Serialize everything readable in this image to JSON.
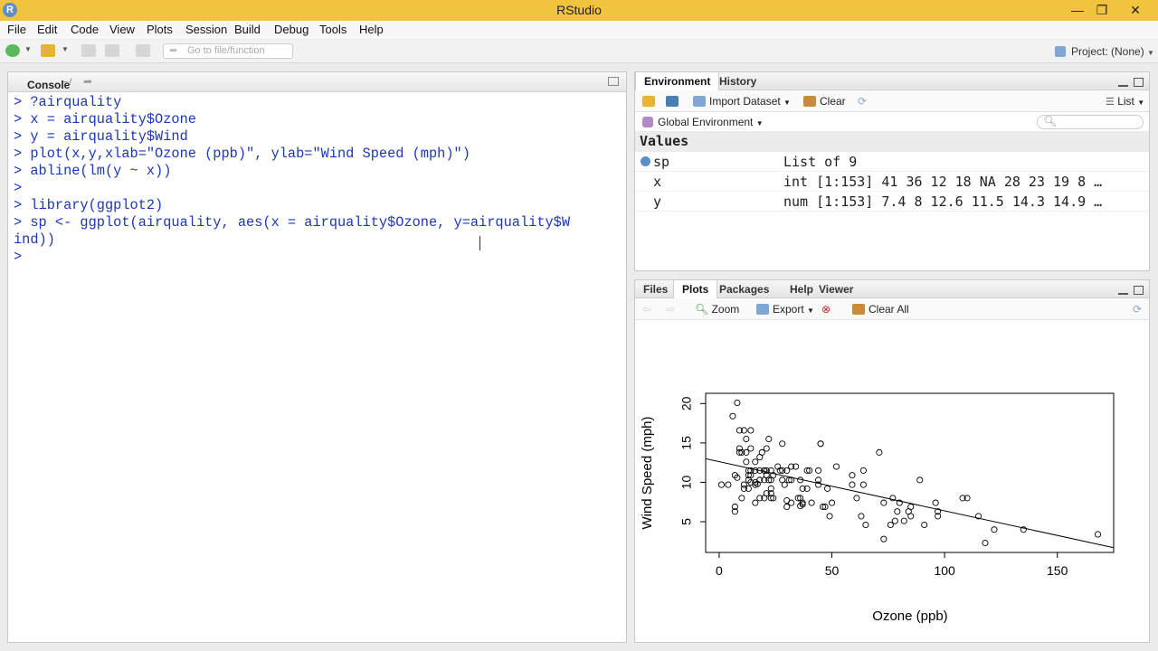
{
  "window": {
    "title": "RStudio",
    "logo_letter": "R",
    "minimize": "—",
    "maximize": "❐",
    "close": "✕"
  },
  "menu": [
    "File",
    "Edit",
    "Code",
    "View",
    "Plots",
    "Session",
    "Build",
    "Debug",
    "Tools",
    "Help"
  ],
  "toolbar": {
    "goto_placeholder": "Go to file/function",
    "project_label": "Project: (None)"
  },
  "console": {
    "tab": "Console",
    "path": "~/",
    "lines": [
      "> ?airquality",
      "> x = airquality$Ozone",
      "> y = airquality$Wind",
      "> plot(x,y,xlab=\"Ozone (ppb)\", ylab=\"Wind Speed (mph)\")",
      "> abline(lm(y ~ x))",
      ">",
      "> library(ggplot2)",
      "> sp <- ggplot(airquality, aes(x = airquality$Ozone, y=airquality$W",
      "ind))",
      ">"
    ]
  },
  "environment": {
    "tabs": [
      "Environment",
      "History"
    ],
    "import_label": "Import Dataset",
    "clear_label": "Clear",
    "view_mode": "List",
    "scope": "Global Environment",
    "section": "Values",
    "rows": [
      {
        "name": "sp",
        "value": "List of 9"
      },
      {
        "name": "x",
        "value": "int [1:153] 41 36 12 18 NA 28 23 19 8 …"
      },
      {
        "name": "y",
        "value": "num [1:153] 7.4 8 12.6 11.5 14.3 14.9 …"
      }
    ]
  },
  "files": {
    "tabs": [
      "Files",
      "Plots",
      "Packages",
      "Help",
      "Viewer"
    ],
    "zoom_label": "Zoom",
    "export_label": "Export",
    "clear_all_label": "Clear All"
  },
  "chart_data": {
    "type": "scatter",
    "title": "",
    "xlabel": "Ozone (ppb)",
    "ylabel": "Wind Speed (mph)",
    "xlim": [
      -6,
      175
    ],
    "ylim": [
      1.1,
      21.3
    ],
    "xticks": [
      0,
      50,
      100,
      150
    ],
    "yticks": [
      5,
      10,
      15,
      20
    ],
    "grid": false,
    "points": [
      [
        41,
        7.4
      ],
      [
        36,
        8.0
      ],
      [
        12,
        12.6
      ],
      [
        18,
        11.5
      ],
      [
        28,
        14.9
      ],
      [
        23,
        8.6
      ],
      [
        19,
        13.8
      ],
      [
        8,
        20.1
      ],
      [
        7,
        6.9
      ],
      [
        16,
        9.7
      ],
      [
        11,
        9.2
      ],
      [
        14,
        10.9
      ],
      [
        18,
        13.2
      ],
      [
        14,
        11.5
      ],
      [
        34,
        12.0
      ],
      [
        6,
        18.4
      ],
      [
        30,
        11.5
      ],
      [
        11,
        9.7
      ],
      [
        1,
        9.7
      ],
      [
        11,
        16.6
      ],
      [
        4,
        9.7
      ],
      [
        32,
        12.0
      ],
      [
        45,
        14.9
      ],
      [
        115,
        5.7
      ],
      [
        37,
        7.4
      ],
      [
        29,
        9.7
      ],
      [
        71,
        13.8
      ],
      [
        39,
        11.5
      ],
      [
        23,
        11.5
      ],
      [
        21,
        10.9
      ],
      [
        37,
        9.2
      ],
      [
        20,
        8.0
      ],
      [
        12,
        13.8
      ],
      [
        13,
        11.5
      ],
      [
        135,
        4.0
      ],
      [
        49,
        5.7
      ],
      [
        32,
        7.4
      ],
      [
        64,
        9.7
      ],
      [
        40,
        11.5
      ],
      [
        77,
        8.0
      ],
      [
        97,
        5.7
      ],
      [
        97,
        6.3
      ],
      [
        85,
        6.9
      ],
      [
        10,
        13.8
      ],
      [
        27,
        11.5
      ],
      [
        7,
        10.9
      ],
      [
        48,
        9.2
      ],
      [
        35,
        8.0
      ],
      [
        61,
        8.0
      ],
      [
        79,
        6.3
      ],
      [
        63,
        5.7
      ],
      [
        16,
        7.4
      ],
      [
        80,
        7.4
      ],
      [
        108,
        8.0
      ],
      [
        20,
        11.5
      ],
      [
        52,
        12.0
      ],
      [
        82,
        5.1
      ],
      [
        50,
        7.4
      ],
      [
        64,
        11.5
      ],
      [
        59,
        9.7
      ],
      [
        39,
        9.2
      ],
      [
        9,
        16.6
      ],
      [
        16,
        11.5
      ],
      [
        122,
        4.0
      ],
      [
        89,
        10.3
      ],
      [
        110,
        8.0
      ],
      [
        44,
        11.5
      ],
      [
        28,
        10.3
      ],
      [
        65,
        4.6
      ],
      [
        22,
        10.3
      ],
      [
        59,
        10.9
      ],
      [
        23,
        9.2
      ],
      [
        31,
        10.3
      ],
      [
        44,
        10.3
      ],
      [
        21,
        14.3
      ],
      [
        9,
        14.3
      ],
      [
        45,
        14.9
      ],
      [
        168,
        3.4
      ],
      [
        73,
        2.8
      ],
      [
        76,
        4.6
      ],
      [
        118,
        2.3
      ],
      [
        84,
        6.3
      ],
      [
        85,
        5.7
      ],
      [
        96,
        7.4
      ],
      [
        78,
        5.1
      ],
      [
        73,
        7.4
      ],
      [
        91,
        4.6
      ],
      [
        47,
        6.9
      ],
      [
        32,
        10.3
      ],
      [
        20,
        10.3
      ],
      [
        23,
        8.0
      ],
      [
        21,
        8.6
      ],
      [
        24,
        10.9
      ],
      [
        44,
        9.7
      ],
      [
        21,
        11.5
      ],
      [
        28,
        11.5
      ],
      [
        9,
        13.8
      ],
      [
        13,
        10.9
      ],
      [
        46,
        6.9
      ],
      [
        18,
        10.3
      ],
      [
        13,
        10.3
      ],
      [
        24,
        8.0
      ],
      [
        16,
        12.6
      ],
      [
        13,
        9.2
      ],
      [
        23,
        10.3
      ],
      [
        36,
        10.3
      ],
      [
        7,
        6.3
      ],
      [
        14,
        16.6
      ],
      [
        30,
        6.9
      ],
      [
        14,
        14.3
      ],
      [
        18,
        8.0
      ],
      [
        20,
        11.5
      ],
      [
        12,
        15.5
      ],
      [
        16,
        10.0
      ],
      [
        8,
        10.6
      ],
      [
        26,
        12.0
      ],
      [
        37,
        7.2
      ],
      [
        22,
        15.5
      ],
      [
        30,
        7.7
      ],
      [
        10,
        8.0
      ],
      [
        17,
        9.8
      ],
      [
        36,
        7.0
      ],
      [
        14,
        10.0
      ]
    ],
    "regression_line": {
      "x0": -6,
      "y0": 13.0,
      "x1": 175,
      "y1": 1.7
    }
  }
}
